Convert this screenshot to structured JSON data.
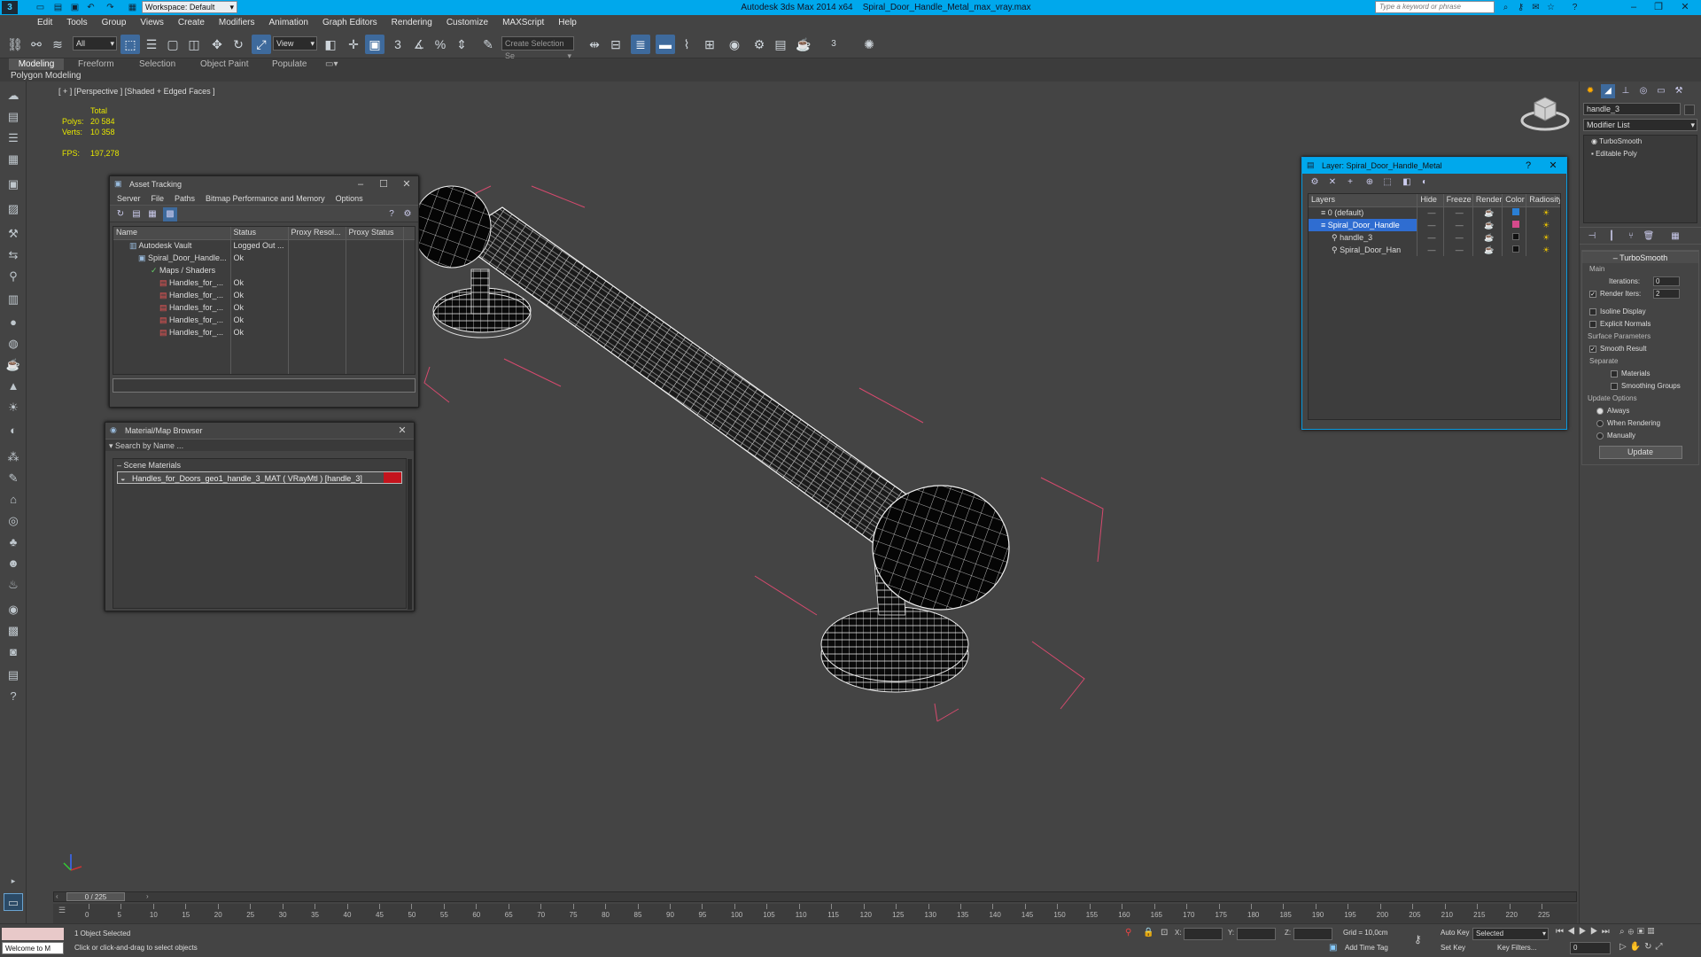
{
  "titlebar": {
    "workspace_label": "Workspace: Default",
    "app_name": "Autodesk 3ds Max  2014 x64",
    "file_name": "Spiral_Door_Handle_Metal_max_vray.max",
    "search_placeholder": "Type a keyword or phrase"
  },
  "menu": [
    "Edit",
    "Tools",
    "Group",
    "Views",
    "Create",
    "Modifiers",
    "Animation",
    "Graph Editors",
    "Rendering",
    "Customize",
    "MAXScript",
    "Help"
  ],
  "toolbar": {
    "filter_value": "All",
    "refcoord_value": "View",
    "named_sel_placeholder": "Create Selection Se",
    "spinner_value": "3"
  },
  "ribbon": {
    "tabs": [
      "Modeling",
      "Freeform",
      "Selection",
      "Object Paint",
      "Populate"
    ],
    "sub_label": "Polygon Modeling"
  },
  "viewport": {
    "label": "[ + ] [Perspective ] [Shaded + Edged Faces ]",
    "stats_total": "Total",
    "polys_label": "Polys:",
    "polys_value": "20 584",
    "verts_label": "Verts:",
    "verts_value": "10 358",
    "fps_label": "FPS:",
    "fps_value": "197,278"
  },
  "asset_tracking": {
    "title": "Asset Tracking",
    "menu": [
      "Server",
      "File",
      "Paths",
      "Bitmap Performance and Memory",
      "Options"
    ],
    "columns": [
      "Name",
      "Status",
      "Proxy Resol...",
      "Proxy Status"
    ],
    "rows": [
      {
        "name": "Autodesk Vault",
        "status": "Logged Out ...",
        "indent": 1
      },
      {
        "name": "Spiral_Door_Handle...",
        "status": "Ok",
        "indent": 2
      },
      {
        "name": "Maps / Shaders",
        "status": "",
        "indent": 3
      },
      {
        "name": "Handles_for_...",
        "status": "Ok",
        "indent": 4
      },
      {
        "name": "Handles_for_...",
        "status": "Ok",
        "indent": 4
      },
      {
        "name": "Handles_for_...",
        "status": "Ok",
        "indent": 4
      },
      {
        "name": "Handles_for_...",
        "status": "Ok",
        "indent": 4
      },
      {
        "name": "Handles_for_...",
        "status": "Ok",
        "indent": 4
      }
    ]
  },
  "material_browser": {
    "title": "Material/Map Browser",
    "search_placeholder": "Search by Name ...",
    "section": "Scene Materials",
    "material_item": "Handles_for_Doors_geo1_handle_3_MAT ( VRayMtl ) [handle_3]"
  },
  "layer_dialog": {
    "title": "Layer: Spiral_Door_Handle_Metal",
    "help": "?",
    "columns": [
      "Layers",
      "Hide",
      "Freeze",
      "Render",
      "Color",
      "Radiosity"
    ],
    "rows": [
      {
        "name": "0 (default)",
        "indent": 1,
        "color": "#2a7fd4",
        "selected": false
      },
      {
        "name": "Spiral_Door_Handle",
        "indent": 1,
        "color": "#d64a8c",
        "selected": true
      },
      {
        "name": "handle_3",
        "indent": 2,
        "color": "#111111",
        "selected": false
      },
      {
        "name": "Spiral_Door_Han",
        "indent": 2,
        "color": "#111111",
        "selected": false
      }
    ],
    "dash": "—"
  },
  "command_panel": {
    "object_name": "handle_3",
    "modifier_list": "Modifier List",
    "stack": [
      "TurboSmooth",
      "Editable Poly"
    ],
    "rollout_title": "TurboSmooth",
    "main_label": "Main",
    "iterations_label": "Iterations:",
    "iterations_value": "0",
    "render_iters_label": "Render Iters:",
    "render_iters_value": "2",
    "isoline_label": "Isoline Display",
    "explicit_label": "Explicit Normals",
    "surface_label": "Surface Parameters",
    "smooth_result_label": "Smooth Result",
    "separate_label": "Separate",
    "materials_label": "Materials",
    "smoothing_label": "Smoothing Groups",
    "update_options_label": "Update Options",
    "always_label": "Always",
    "when_rendering_label": "When Rendering",
    "manually_label": "Manually",
    "update_button": "Update"
  },
  "timeline": {
    "frame_readout": "0 / 225",
    "ticks": [
      0,
      5,
      10,
      15,
      20,
      25,
      30,
      35,
      40,
      45,
      50,
      55,
      60,
      65,
      70,
      75,
      80,
      85,
      90,
      95,
      100,
      105,
      110,
      115,
      120,
      125,
      130,
      135,
      140,
      145,
      150,
      155,
      160,
      165,
      170,
      175,
      180,
      185,
      190,
      195,
      200,
      205,
      210,
      215,
      220,
      225
    ]
  },
  "status": {
    "maxscript": "Welcome to M",
    "selection": "1 Object Selected",
    "prompt": "Click or click-and-drag to select objects",
    "x_label": "X:",
    "y_label": "Y:",
    "z_label": "Z:",
    "grid": "Grid = 10,0cm",
    "add_time_tag": "Add Time Tag",
    "auto_key": "Auto Key",
    "set_key": "Set Key",
    "selected_value": "Selected",
    "key_filters": "Key Filters...",
    "frame_value": "0"
  },
  "colors": {
    "titlebar": "#00a8ec",
    "selection_blue": "#2f6dd1",
    "bbox": "#d64a6e",
    "fps": "#e6e600"
  }
}
